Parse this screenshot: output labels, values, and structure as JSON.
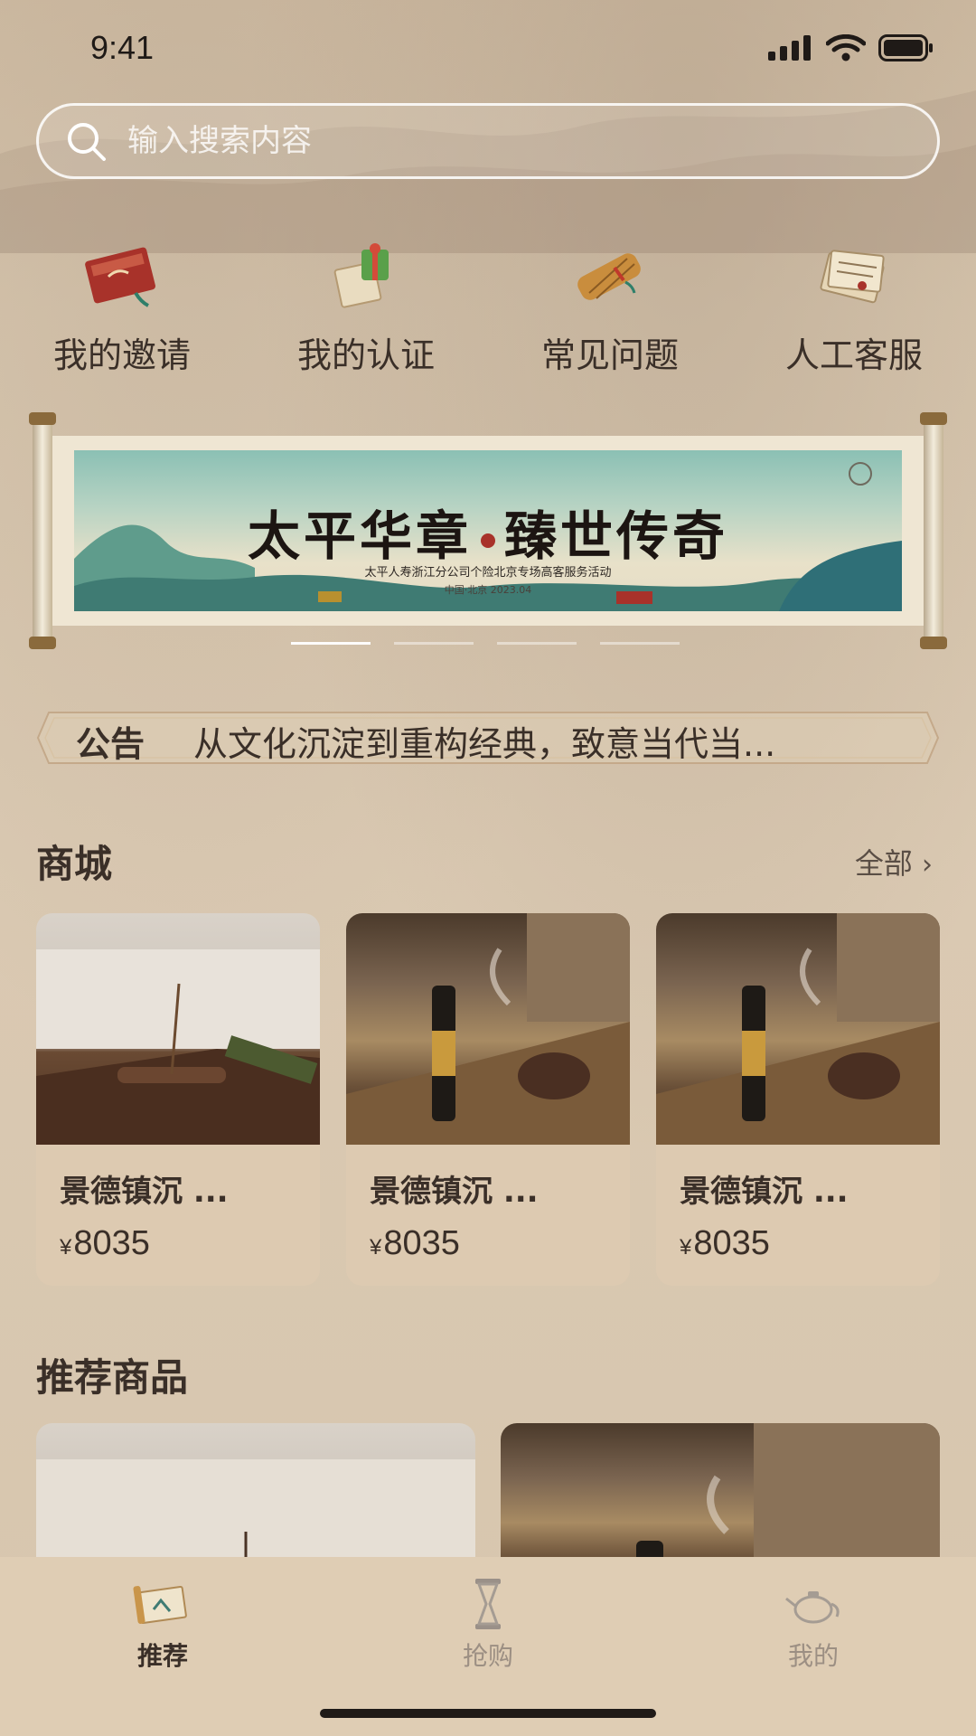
{
  "status_bar": {
    "time": "9:41"
  },
  "search": {
    "placeholder": "输入搜索内容"
  },
  "quick_menu": [
    {
      "label": "我的邀请",
      "icon": "red-envelope-icon"
    },
    {
      "label": "我的认证",
      "icon": "scroll-gift-icon"
    },
    {
      "label": "常见问题",
      "icon": "bamboo-scroll-icon"
    },
    {
      "label": "人工客服",
      "icon": "letter-bundle-icon"
    }
  ],
  "banner": {
    "title_left": "太平华章",
    "title_right": "臻世传奇",
    "subtitle": "太平人寿浙江分公司个险北京专场高客服务活动",
    "date": "中国·北京  2023.04",
    "slides": 4,
    "active_slide": 1
  },
  "notice": {
    "label": "公告",
    "text": "从文化沉淀到重构经典，致意当代当..."
  },
  "mall": {
    "title": "商城",
    "more_label": "全部",
    "products": [
      {
        "name": "景德镇沉 ...",
        "currency": "¥",
        "price": "8035",
        "image": "incense-bedroom"
      },
      {
        "name": "景德镇沉 ...",
        "currency": "¥",
        "price": "8035",
        "image": "incense-tea-table"
      },
      {
        "name": "景德镇沉 ...",
        "currency": "¥",
        "price": "8035",
        "image": "incense-tea-table"
      }
    ]
  },
  "recommended": {
    "title": "推荐商品"
  },
  "tab_bar": {
    "tabs": [
      {
        "label": "推荐",
        "icon": "painting-scroll-icon",
        "active": true
      },
      {
        "label": "抢购",
        "icon": "hourglass-icon",
        "active": false
      },
      {
        "label": "我的",
        "icon": "teapot-icon",
        "active": false
      }
    ]
  },
  "colors": {
    "background": "#d8c8b1",
    "text_primary": "#3a2f28",
    "tab_inactive": "#9c8f83",
    "accent_red": "#a8322a"
  }
}
